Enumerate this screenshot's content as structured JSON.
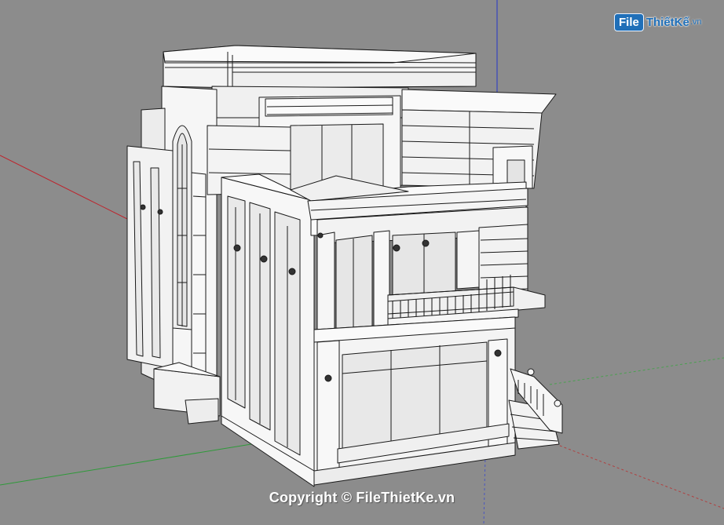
{
  "watermark": {
    "logo_box": "File",
    "logo_text": "ThiếtKế",
    "logo_ext": ".vn",
    "copyright": "Copyright © FileThietKe.vn"
  },
  "colors": {
    "background": "#8c8c8c",
    "axis_red": "#c0202a",
    "axis_green": "#2f9a3a",
    "axis_blue": "#2434c8",
    "wall": "#f4f4f4",
    "line": "#1a1a1a",
    "glass": "#e9e9e9",
    "logo_blue": "#1f6fb8"
  },
  "icons": [
    "house-3d-model",
    "axis-lines",
    "filethietke-logo"
  ]
}
